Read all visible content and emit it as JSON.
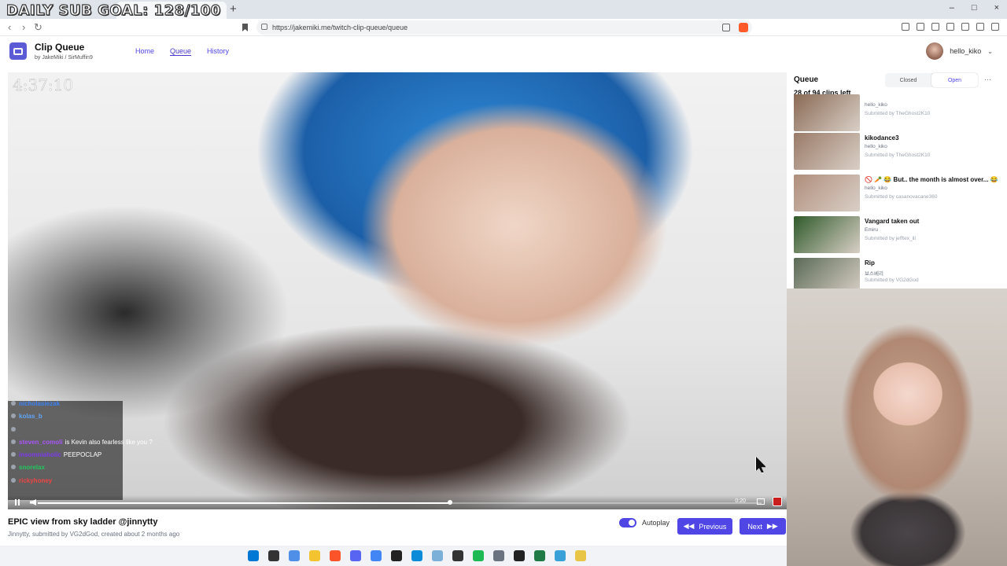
{
  "overlay": {
    "sub_goal": "DAILY SUB GOAL: 128/100",
    "stream_timer": "4:37:10"
  },
  "browser": {
    "tab_title": "",
    "tab_close": "×",
    "new_tab": "+",
    "win_min": "–",
    "win_max": "□",
    "win_close": "×",
    "back": "‹",
    "forward": "›",
    "reload": "↻",
    "url": "https://jakemiki.me/twitch-clip-queue/queue"
  },
  "app": {
    "title": "Clip Queue",
    "by_prefix": "by",
    "author1": "JakeMiki",
    "separator": "/",
    "author2": "SirMuffin9",
    "nav": [
      "Home",
      "Queue",
      "History"
    ],
    "user_name": "hello_kiko"
  },
  "chat": [
    {
      "user": "nicholasiezak",
      "msg": "",
      "color": "#3b82f6"
    },
    {
      "user": "kolas_b",
      "msg": "",
      "color": "#60a5fa"
    },
    {
      "user": "",
      "msg": "",
      "color": "#ef4444"
    },
    {
      "user": "steven_comoli",
      "msg": "is Kevin also fearless like you ?",
      "color": "#a855f7"
    },
    {
      "user": "insomniaholic",
      "msg": "PEEPOCLAP",
      "color": "#7c3aed"
    },
    {
      "user": "snorelax",
      "msg": "",
      "color": "#22c55e"
    },
    {
      "user": "rickyhoney",
      "msg": "",
      "color": "#ef4444"
    }
  ],
  "player": {
    "time": "0:20",
    "progress": 0.57
  },
  "clip": {
    "title": "EPIC view from sky ladder @jinnytty",
    "channel": "Jinnytty",
    "submitted_by_label": "submitted by",
    "submitter": "VG2dGod",
    "created": "created about 2 months ago"
  },
  "controls": {
    "autoplay_label": "Autoplay",
    "previous_label": "Previous",
    "next_label": "Next"
  },
  "queue": {
    "title": "Queue",
    "count": "28 of 94 clips left",
    "closed_label": "Closed",
    "open_label": "Open",
    "menu": "⋯",
    "items": [
      {
        "title": "",
        "channel": "hello_kiko",
        "submitted": "Submitted by TheGhost2K10",
        "thumb": "#8a6a55",
        "partial": true
      },
      {
        "title": "kikodance3",
        "channel": "hello_kiko",
        "submitted": "Submitted by TheGhost2K10",
        "thumb": "#9a7a68"
      },
      {
        "title": "🚫 🥕 😂 But.. the month is almost over... 😂",
        "channel": "hello_kiko",
        "submitted": "Submitted by casanovacane360",
        "thumb": "#b08e7c"
      },
      {
        "title": "Vangard taken out",
        "channel": "Emiru",
        "submitted": "Submitted by jefftex_ill",
        "thumb": "#2f5a2a"
      },
      {
        "title": "Rip",
        "channel": "보스베리",
        "submitted": "Submitted by VG2dGod",
        "thumb": "#5a6a55"
      }
    ]
  },
  "taskbar": {
    "icons": [
      "windows-icon",
      "explorer-icon",
      "photos-icon",
      "folder-icon",
      "brave-icon",
      "discord-icon",
      "chrome-icon",
      "obs-icon",
      "edge-icon",
      "git-icon",
      "terminal-icon",
      "spotify-icon",
      "settings-icon",
      "app-icon",
      "excel-icon",
      "notes-icon",
      "tool-icon"
    ],
    "colors": [
      "#0078d4",
      "#333333",
      "#4f8fe8",
      "#f4c430",
      "#fb542b",
      "#5865f2",
      "#4285f4",
      "#222222",
      "#0c8bd8",
      "#7cb0d8",
      "#333333",
      "#1db954",
      "#6b7280",
      "#222222",
      "#1f7a45",
      "#3aa0d8",
      "#e8c547"
    ]
  }
}
